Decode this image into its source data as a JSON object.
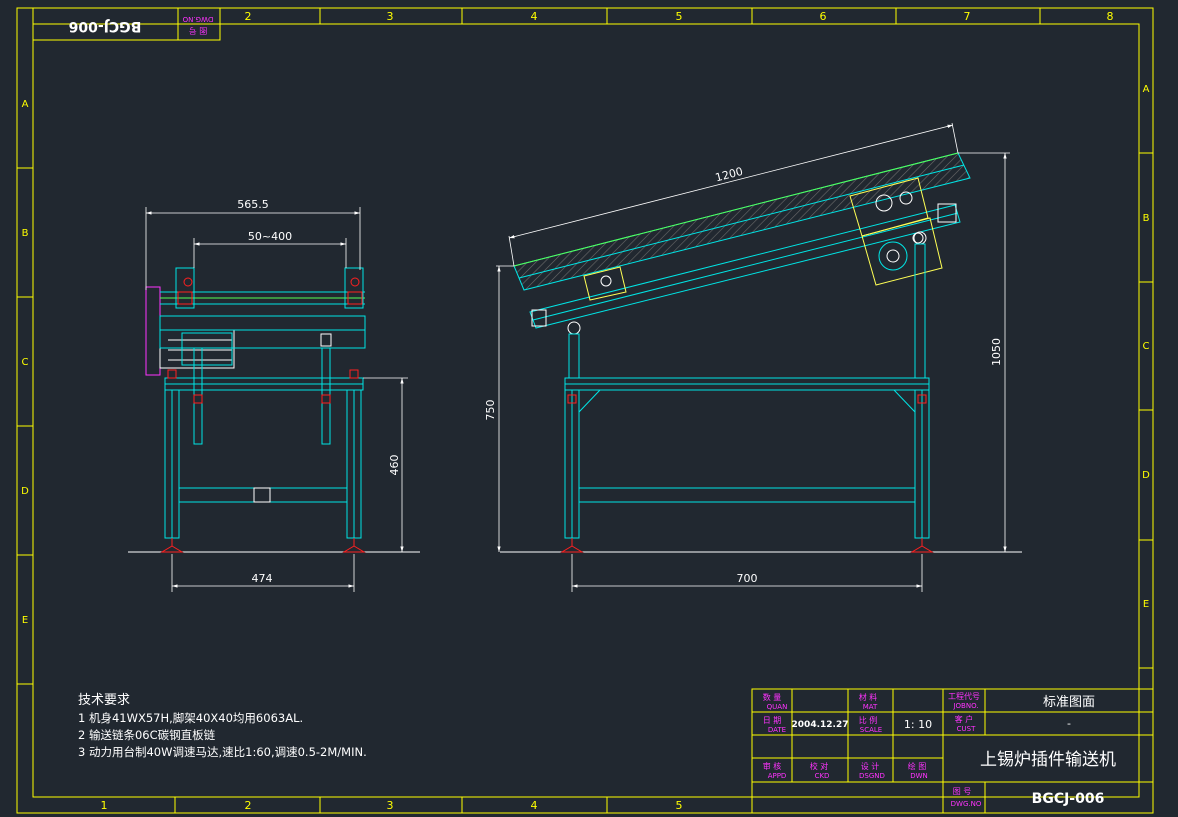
{
  "frame": {
    "top_zones": [
      "2",
      "3",
      "4",
      "5",
      "6",
      "7",
      "8"
    ],
    "bottom_zones": [
      "1",
      "2",
      "3",
      "4",
      "5"
    ],
    "left_zones": [
      "A",
      "B",
      "C",
      "D",
      "E"
    ],
    "right_zones": [
      "A",
      "B",
      "C",
      "D",
      "E"
    ],
    "corner_stamp": {
      "drawing_no": "BGCJ-006",
      "label_cn": "图 号",
      "label_en": "DWG.NO"
    }
  },
  "dimensions": {
    "width_overall": "565.5",
    "width_range": "50~400",
    "leg_spacing_front": "474",
    "height_front": "460",
    "length": "1200",
    "height_high": "1050",
    "height_low": "750",
    "leg_spacing_side": "700"
  },
  "notes": {
    "heading": "技术要求",
    "items": [
      "1 机身41WX57H,脚架40X40均用6063AL.",
      "2 输送链条06C碳钢直板链",
      "3 动力用台制40W调速马达,速比1:60,调速0.5-2M/MIN."
    ]
  },
  "title_block": {
    "quan_cn": "数 量",
    "quan_en": "QUAN",
    "mat_cn": "材 料",
    "mat_en": "MAT",
    "jobno_cn": "工程代号",
    "jobno_en": "JOBNO.",
    "jobno_value": "标准图面",
    "date_cn": "日 期",
    "date_en": "DATE",
    "date_value": "2004.12.27",
    "scale_cn": "比 例",
    "scale_en": "SCALE",
    "scale_value": "1: 10",
    "cust_cn": "客 户",
    "cust_en": "CUST",
    "cust_value": "-",
    "title": "上锡炉插件输送机",
    "appd_cn": "审 核",
    "appd_en": "APPD",
    "ckd_cn": "校 对",
    "ckd_en": "CKD",
    "dsgnd_cn": "设 计",
    "dsgnd_en": "DSGND",
    "dwn_cn": "绘 图",
    "dwn_en": "DWN",
    "dwgno_cn": "图 号",
    "dwgno_en": "DWG.NO",
    "dwgno_value": "BGCJ-006"
  },
  "colors": {
    "background": "#212830",
    "frame": "#ffff00",
    "structure": "#00e5e5",
    "dimension": "#ffffff",
    "accent": "#ff2020",
    "label": "#ff33ff",
    "motor_plate": "#ffff55",
    "belt": "#55ff55"
  }
}
